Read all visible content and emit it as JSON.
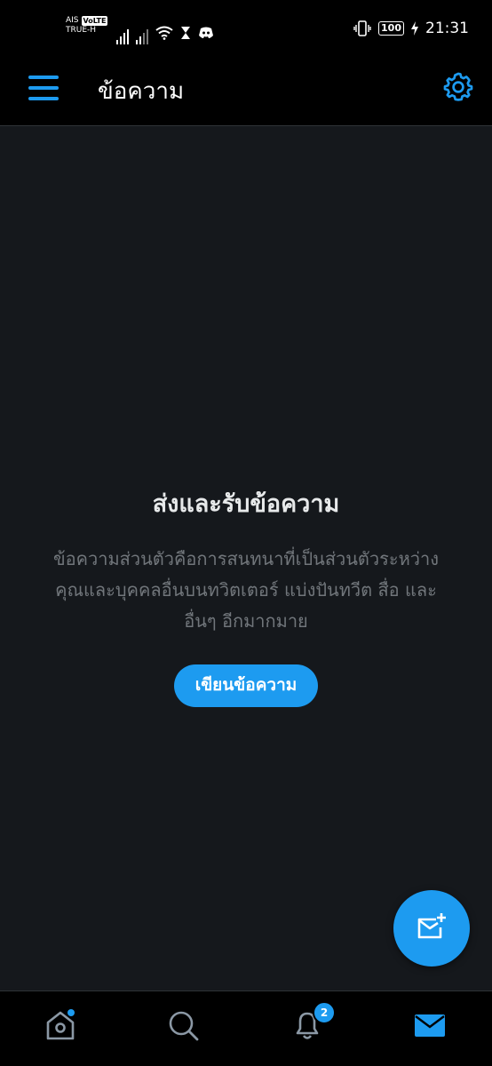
{
  "status_bar": {
    "carrier_top": "AIS",
    "volte": "VoLTE",
    "carrier_bottom": "TRUE-H",
    "battery": "100",
    "time": "21:31",
    "icons": [
      "signal-icon",
      "signal-icon",
      "wifi-icon",
      "hourglass-icon",
      "discord-icon",
      "vibrate-icon",
      "battery-icon",
      "charging-icon"
    ]
  },
  "header": {
    "title": "ข้อความ",
    "menu_icon": "menu-icon",
    "settings_icon": "gear-icon"
  },
  "empty_state": {
    "title": "ส่งและรับข้อความ",
    "description_lines": [
      "ข้อความส่วนตัวคือการสนทนาที่เป็นส่วนตัวระหว่าง",
      "คุณและบุคคลอื่นบนทวิตเตอร์ แบ่งปันทวีต สื่อ และ",
      "อื่นๆ อีกมากมาย"
    ],
    "button_label": "เขียนข้อความ"
  },
  "fab": {
    "icon": "new-message-icon"
  },
  "bottom_nav": {
    "items": [
      {
        "icon": "home-icon",
        "active": false,
        "dot": true
      },
      {
        "icon": "search-icon",
        "active": false
      },
      {
        "icon": "bell-icon",
        "active": false,
        "badge": "2"
      },
      {
        "icon": "mail-icon",
        "active": true
      }
    ]
  },
  "colors": {
    "accent": "#1d9bf0",
    "background": "#15181c",
    "bar": "#000000",
    "text_primary": "#e7e9ea",
    "text_secondary": "#71767b"
  }
}
